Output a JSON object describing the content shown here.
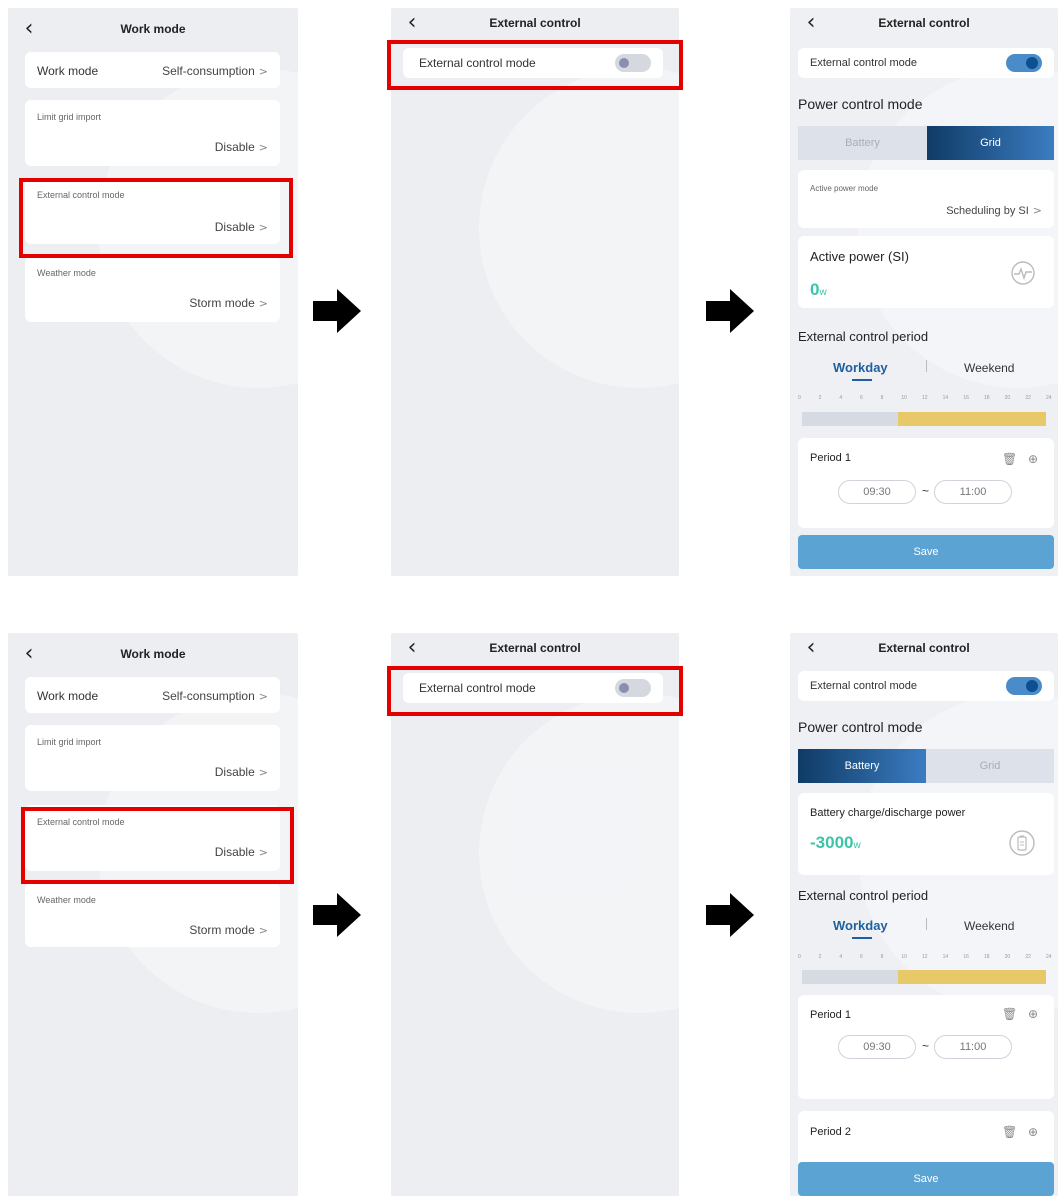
{
  "work_mode_screen": {
    "title": "Work mode",
    "work_mode_label": "Work mode",
    "work_mode_value": "Self-consumption",
    "limit_grid_label": "Limit grid import",
    "limit_grid_value": "Disable",
    "external_label": "External control mode",
    "external_value": "Disable",
    "weather_label": "Weather mode",
    "weather_value": "Storm mode"
  },
  "external_off_screen": {
    "title": "External control",
    "toggle_label": "External control mode"
  },
  "external_grid_screen": {
    "title": "External control",
    "toggle_label": "External control mode",
    "power_control_title": "Power control mode",
    "seg_battery": "Battery",
    "seg_grid": "Grid",
    "active_power_mode_label": "Active power mode",
    "active_power_mode_value": "Scheduling by SI",
    "active_power_label": "Active power (SI)",
    "active_power_value": "0",
    "active_power_unit": "w",
    "period_section_title": "External control period",
    "tab_workday": "Workday",
    "tab_weekend": "Weekend",
    "period1_title": "Period 1",
    "period1_start": "09:30",
    "period1_end": "11:00",
    "tilde": "~",
    "save_label": "Save"
  },
  "external_battery_screen": {
    "title": "External control",
    "toggle_label": "External control mode",
    "power_control_title": "Power control mode",
    "seg_battery": "Battery",
    "seg_grid": "Grid",
    "battery_power_label": "Battery charge/discharge power",
    "battery_power_value": "-3000",
    "battery_power_unit": "w",
    "period_section_title": "External control period",
    "tab_workday": "Workday",
    "tab_weekend": "Weekend",
    "period1_title": "Period 1",
    "period1_start": "09:30",
    "period1_end": "11:00",
    "period2_title": "Period 2",
    "tilde": "~",
    "save_label": "Save"
  },
  "timeline_ticks": [
    "0",
    "2",
    "4",
    "6",
    "8",
    "10",
    "12",
    "14",
    "16",
    "18",
    "20",
    "22",
    "24"
  ],
  "chev": ">",
  "icons": {
    "back": "chevron-left-icon",
    "arrow": "arrow-right-icon",
    "trash": "trash-icon",
    "add": "add-circle-icon",
    "pulse": "power-pulse-icon",
    "battery": "battery-icon"
  },
  "colors": {
    "highlight": "#e50000",
    "accent": "#1f5f9e",
    "value_green": "#3cc4a8",
    "save": "#5ba3d3",
    "schedule_active": "#e8c96a"
  }
}
